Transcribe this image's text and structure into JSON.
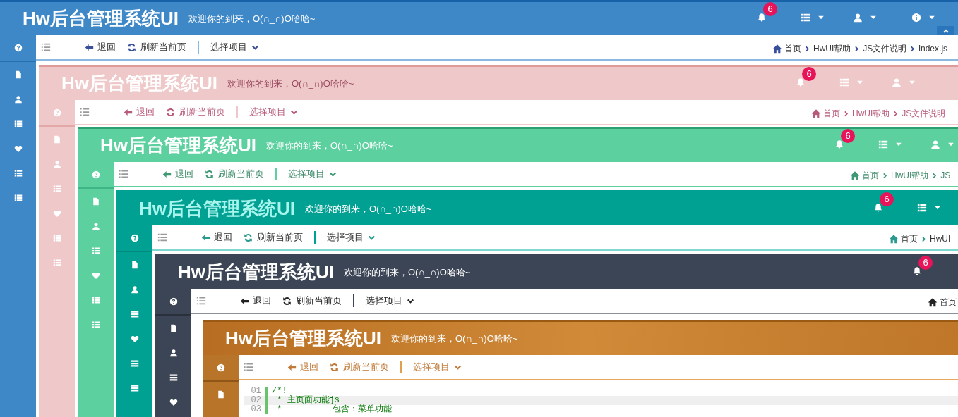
{
  "frames": [
    {
      "kind": "blue",
      "title": "Hw后台管理系统UI",
      "subtitle": "欢迎你的到来，O(∩_∩)O哈哈~",
      "header_items": [
        {
          "kind": "notifications",
          "badge": "6"
        },
        {
          "kind": "list_menu"
        },
        {
          "kind": "user_menu"
        },
        {
          "kind": "info_menu"
        }
      ],
      "scroll_top_button": true,
      "sidebar": [
        {
          "kind": "help"
        },
        {
          "kind": "file"
        },
        {
          "kind": "user"
        },
        {
          "kind": "list"
        },
        {
          "kind": "heart"
        },
        {
          "kind": "list"
        },
        {
          "kind": "list"
        }
      ],
      "toolbar": {
        "back": "退回",
        "refresh": "刷新当前页",
        "project_select": "选择项目"
      },
      "breadcrumb": [
        "首页",
        "HwUI帮助",
        "JS文件说明",
        "index.js"
      ]
    },
    {
      "kind": "pink",
      "title": "Hw后台管理系统UI",
      "subtitle": "欢迎你的到来，O(∩_∩)O哈哈~",
      "header_items": [
        {
          "kind": "notifications",
          "badge": "6"
        },
        {
          "kind": "list_menu"
        },
        {
          "kind": "user_menu"
        }
      ],
      "sidebar": [
        {
          "kind": "help"
        },
        {
          "kind": "file"
        },
        {
          "kind": "user"
        },
        {
          "kind": "list"
        },
        {
          "kind": "heart"
        },
        {
          "kind": "list"
        },
        {
          "kind": "list"
        }
      ],
      "toolbar": {
        "back": "退回",
        "refresh": "刷新当前页",
        "project_select": "选择项目"
      },
      "breadcrumb": [
        "首页",
        "HwUI帮助",
        "JS文件说明"
      ]
    },
    {
      "kind": "green",
      "title": "Hw后台管理系统UI",
      "subtitle": "欢迎你的到来，O(∩_∩)O哈哈~",
      "header_items": [
        {
          "kind": "notifications",
          "badge": "6"
        },
        {
          "kind": "list_menu"
        },
        {
          "kind": "user_menu"
        }
      ],
      "sidebar": [
        {
          "kind": "help"
        },
        {
          "kind": "file"
        },
        {
          "kind": "user"
        },
        {
          "kind": "list"
        },
        {
          "kind": "heart"
        },
        {
          "kind": "list"
        },
        {
          "kind": "list"
        }
      ],
      "toolbar": {
        "back": "退回",
        "refresh": "刷新当前页",
        "project_select": "选择项目"
      },
      "breadcrumb": [
        "首页",
        "HwUI帮助",
        "JS"
      ]
    },
    {
      "kind": "teal",
      "title": "Hw后台管理系统UI",
      "subtitle": "欢迎你的到来，O(∩_∩)O哈哈~",
      "header_items": [
        {
          "kind": "notifications",
          "badge": "6"
        },
        {
          "kind": "list_menu"
        }
      ],
      "sidebar": [
        {
          "kind": "help"
        },
        {
          "kind": "file"
        },
        {
          "kind": "user"
        },
        {
          "kind": "list"
        },
        {
          "kind": "heart"
        },
        {
          "kind": "list"
        },
        {
          "kind": "list"
        }
      ],
      "toolbar": {
        "back": "退回",
        "refresh": "刷新当前页",
        "project_select": "选择项目"
      },
      "breadcrumb": [
        "首页",
        "HwUI"
      ]
    },
    {
      "kind": "dark",
      "title": "Hw后台管理系统UI",
      "subtitle": "欢迎你的到来，O(∩_∩)O哈哈~",
      "header_items": [
        {
          "kind": "notifications",
          "badge": "6"
        }
      ],
      "sidebar": [
        {
          "kind": "help"
        },
        {
          "kind": "file"
        },
        {
          "kind": "user"
        },
        {
          "kind": "list"
        },
        {
          "kind": "heart"
        }
      ],
      "toolbar": {
        "back": "退回",
        "refresh": "刷新当前页",
        "project_select": "选择项目"
      },
      "breadcrumb": [
        "首页"
      ]
    },
    {
      "kind": "orange",
      "title": "Hw后台管理系统UI",
      "subtitle": "欢迎你的到来，O(∩_∩)O哈哈~",
      "sidebar": [
        {
          "kind": "help"
        },
        {
          "kind": "file"
        }
      ],
      "toolbar": {
        "back": "退回",
        "refresh": "刷新当前页",
        "project_select": "选择项目"
      }
    }
  ],
  "code": {
    "lines": [
      {
        "number": "01",
        "text": "/*!",
        "highlighted": false
      },
      {
        "number": "02",
        "text": " * 主页面功能js",
        "highlighted": true
      },
      {
        "number": "03",
        "text": " *          包含：菜单功能",
        "highlighted": false
      }
    ]
  }
}
